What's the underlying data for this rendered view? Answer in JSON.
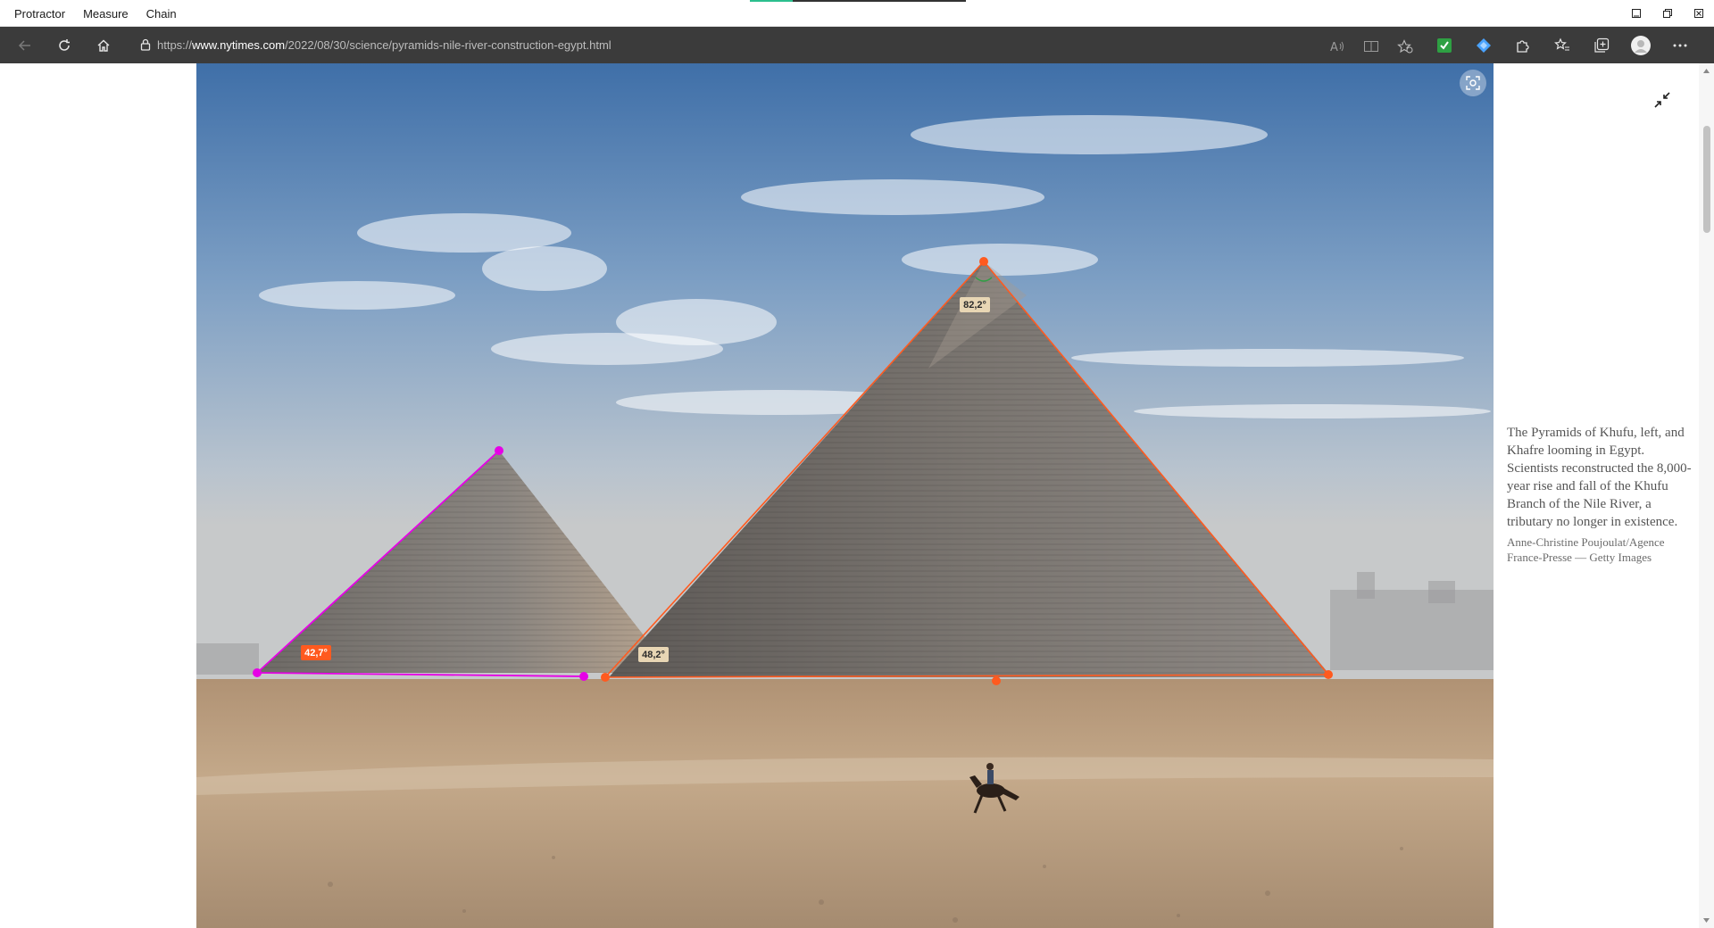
{
  "app_menu": {
    "items": [
      "Protractor",
      "Measure",
      "Chain"
    ]
  },
  "window_controls": {
    "minimize_icon": "minimize-icon",
    "restore_icon": "restore-icon",
    "close_icon": "close-icon"
  },
  "browser": {
    "url_prefix": "https://",
    "url_domain": "www.nytimes.com",
    "url_path": "/2022/08/30/science/pyramids-nile-river-construction-egypt.html",
    "extension_accent": "#4aa3ff",
    "extension_check_color": "#2ea043"
  },
  "article": {
    "caption": "The Pyramids of Khufu, left, and Khafre looming in Egypt. Scientists reconstructed the 8,000-year rise and fall of the Khufu Branch of the Nile River, a tributary no longer in existence.",
    "credit": "Anne-Christine Poujoulat/Agence France-Presse — Getty Images"
  },
  "measurements": {
    "left_angle": "42,7°",
    "apex_angle": "82,2°",
    "right_base_angle": "48,2°",
    "left_color": "#e600e6",
    "right_color": "#ff5a1f"
  }
}
